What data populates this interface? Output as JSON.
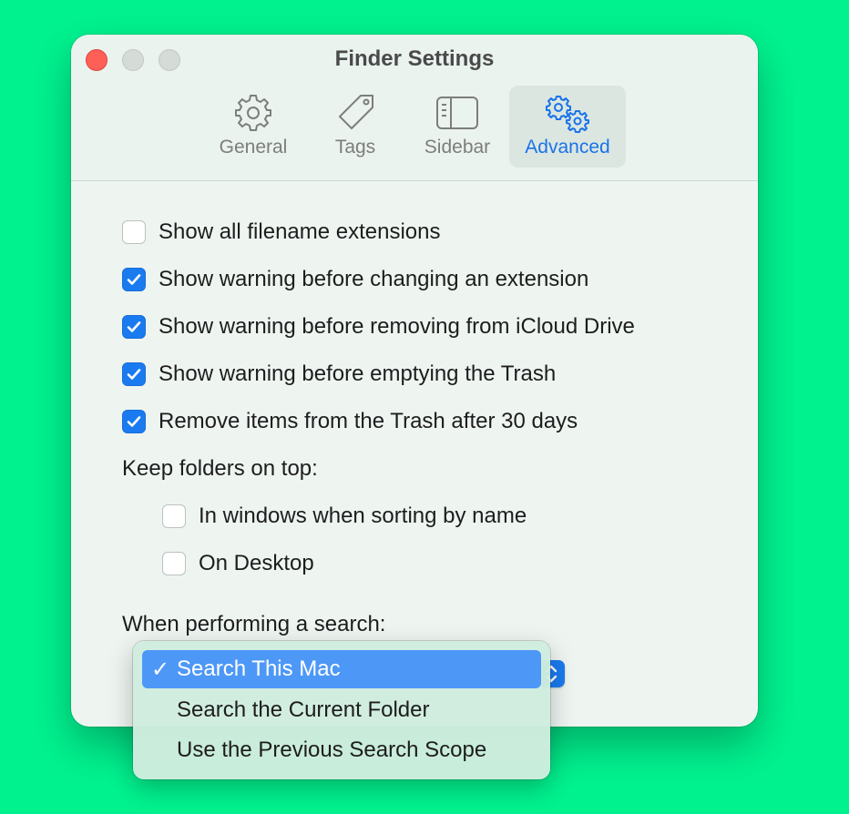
{
  "window": {
    "title": "Finder Settings"
  },
  "tabs": [
    {
      "label": "General",
      "icon": "gear-icon"
    },
    {
      "label": "Tags",
      "icon": "tag-icon"
    },
    {
      "label": "Sidebar",
      "icon": "sidebar-icon"
    },
    {
      "label": "Advanced",
      "icon": "gears-icon",
      "active": true
    }
  ],
  "options": [
    {
      "label": "Show all filename extensions",
      "checked": false
    },
    {
      "label": "Show warning before changing an extension",
      "checked": true
    },
    {
      "label": "Show warning before removing from iCloud Drive",
      "checked": true
    },
    {
      "label": "Show warning before emptying the Trash",
      "checked": true
    },
    {
      "label": "Remove items from the Trash after 30 days",
      "checked": true
    }
  ],
  "keep_folders": {
    "label": "Keep folders on top:",
    "options": [
      {
        "label": "In windows when sorting by name",
        "checked": false
      },
      {
        "label": "On Desktop",
        "checked": false
      }
    ]
  },
  "search": {
    "label": "When performing a search:",
    "menu": [
      {
        "label": "Search This Mac",
        "selected": true
      },
      {
        "label": "Search the Current Folder",
        "selected": false
      },
      {
        "label": "Use the Previous Search Scope",
        "selected": false
      }
    ],
    "check_mark": "✓"
  },
  "colors": {
    "background": "#00f28f",
    "accent": "#1a7bf0",
    "selected_menu": "#4d98f7",
    "close_button": "#fe5f57"
  }
}
